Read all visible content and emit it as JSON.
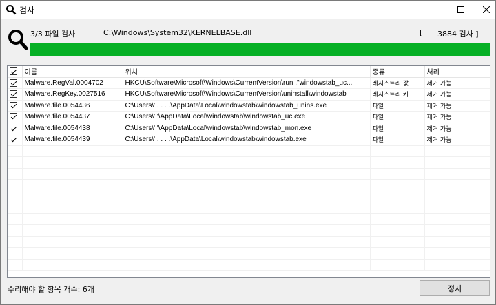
{
  "window": {
    "title": "검사"
  },
  "scan": {
    "count": "3/3 파일 검사",
    "current_path": "C:\\Windows\\System32\\KERNELBASE.dll",
    "bracket_open": "[",
    "total": "3884 검사 ]",
    "progress": 1.0
  },
  "table": {
    "headers": [
      "이름",
      "위치",
      "종류",
      "처리"
    ],
    "rows": [
      {
        "checked": true,
        "name": "Malware.RegVal.0004702",
        "location": "HKCU\\Software\\Microsoft\\Windows\\CurrentVersion\\run ,\"windowstab_uc...",
        "type": "레지스트리 값",
        "action": "제거 가능"
      },
      {
        "checked": true,
        "name": "Malware.RegKey.0027516",
        "location": "HKCU\\Software\\Microsoft\\Windows\\CurrentVersion\\uninstall\\windowstab",
        "type": "레지스트리 키",
        "action": "제거 가능"
      },
      {
        "checked": true,
        "name": "Malware.file.0054436",
        "location": "C:\\Users\\'        . . .     .\\AppData\\Local\\windowstab\\windowstab_unins.exe",
        "type": "파일",
        "action": "제거 가능"
      },
      {
        "checked": true,
        "name": "Malware.file.0054437",
        "location": "C:\\Users\\'                   '\\AppData\\Local\\windowstab\\windowstab_uc.exe",
        "type": "파일",
        "action": "제거 가능"
      },
      {
        "checked": true,
        "name": "Malware.file.0054438",
        "location": "C:\\Users\\'                   '\\AppData\\Local\\windowstab\\windowstab_mon.exe",
        "type": "파일",
        "action": "제거 가능"
      },
      {
        "checked": true,
        "name": "Malware.file.0054439",
        "location": "C:\\Users\\'        . . .     .\\AppData\\Local\\windowstab\\windowstab.exe",
        "type": "파일",
        "action": "제거 가능"
      }
    ]
  },
  "footer": {
    "status": "수리해야 할 항목 개수: 6개",
    "stop_label": "정지"
  },
  "icons": {
    "title": "search-icon",
    "big": "search-icon"
  }
}
